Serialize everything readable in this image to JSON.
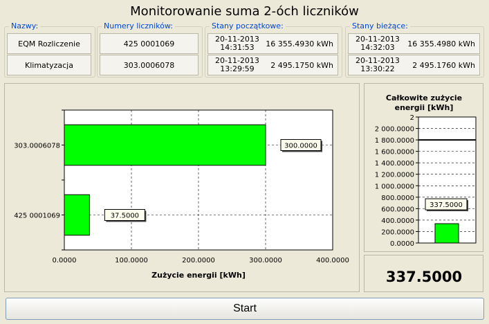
{
  "title": "Monitorowanie suma 2-óch liczników",
  "groups": {
    "names": {
      "label": "Nazwy:",
      "rows": [
        "EQM Rozliczenie",
        "Klimatyzacja"
      ]
    },
    "numbers": {
      "label": "Numery liczników:",
      "rows": [
        "425 0001069",
        "303.0006078"
      ]
    },
    "start_states": {
      "label": "Stany początkowe:",
      "rows": [
        {
          "date": "20-11-2013",
          "time": "14:31:53",
          "value": "16 355.4930 kWh"
        },
        {
          "date": "20-11-2013",
          "time": "13:29:59",
          "value": "2 495.1750 kWh"
        }
      ]
    },
    "current_states": {
      "label": "Stany bieżące:",
      "rows": [
        {
          "date": "20-11-2013",
          "time": "14:32:03",
          "value": "16 355.4980 kWh"
        },
        {
          "date": "20-11-2013",
          "time": "13:30:22",
          "value": "2 495.1760 kWh"
        }
      ]
    }
  },
  "chart_data": [
    {
      "type": "bar",
      "orientation": "horizontal",
      "categories": [
        "303.0006078",
        "425 0001069"
      ],
      "values": [
        300,
        37.5
      ],
      "value_labels": [
        "300.0000",
        "37.5000"
      ],
      "xlabel": "Zużycie energii [kWh]",
      "ylabel": "",
      "xlim": [
        0,
        400
      ],
      "xticks": [
        "0.0000",
        "100.0000",
        "200.0000",
        "300.0000",
        "400.0000"
      ],
      "grid": true,
      "bar_color": "#00ff00"
    },
    {
      "type": "bar",
      "orientation": "vertical",
      "title": "Całkowite zużycie energii [kWh]",
      "values": [
        337.5
      ],
      "value_labels": [
        "337.5000"
      ],
      "ylim": [
        0,
        2200
      ],
      "yticks": [
        "0.0000",
        "200.0000",
        "400.0000",
        "600.0000",
        "800.0000",
        "1 000.0000",
        "1 200.0000",
        "1 400.0000",
        "1 600.0000",
        "1 800.0000",
        "2 000.0000",
        "2"
      ],
      "threshold": 1800,
      "bar_color": "#00ff00"
    }
  ],
  "total_value": "337.5000",
  "start_label": "Start"
}
